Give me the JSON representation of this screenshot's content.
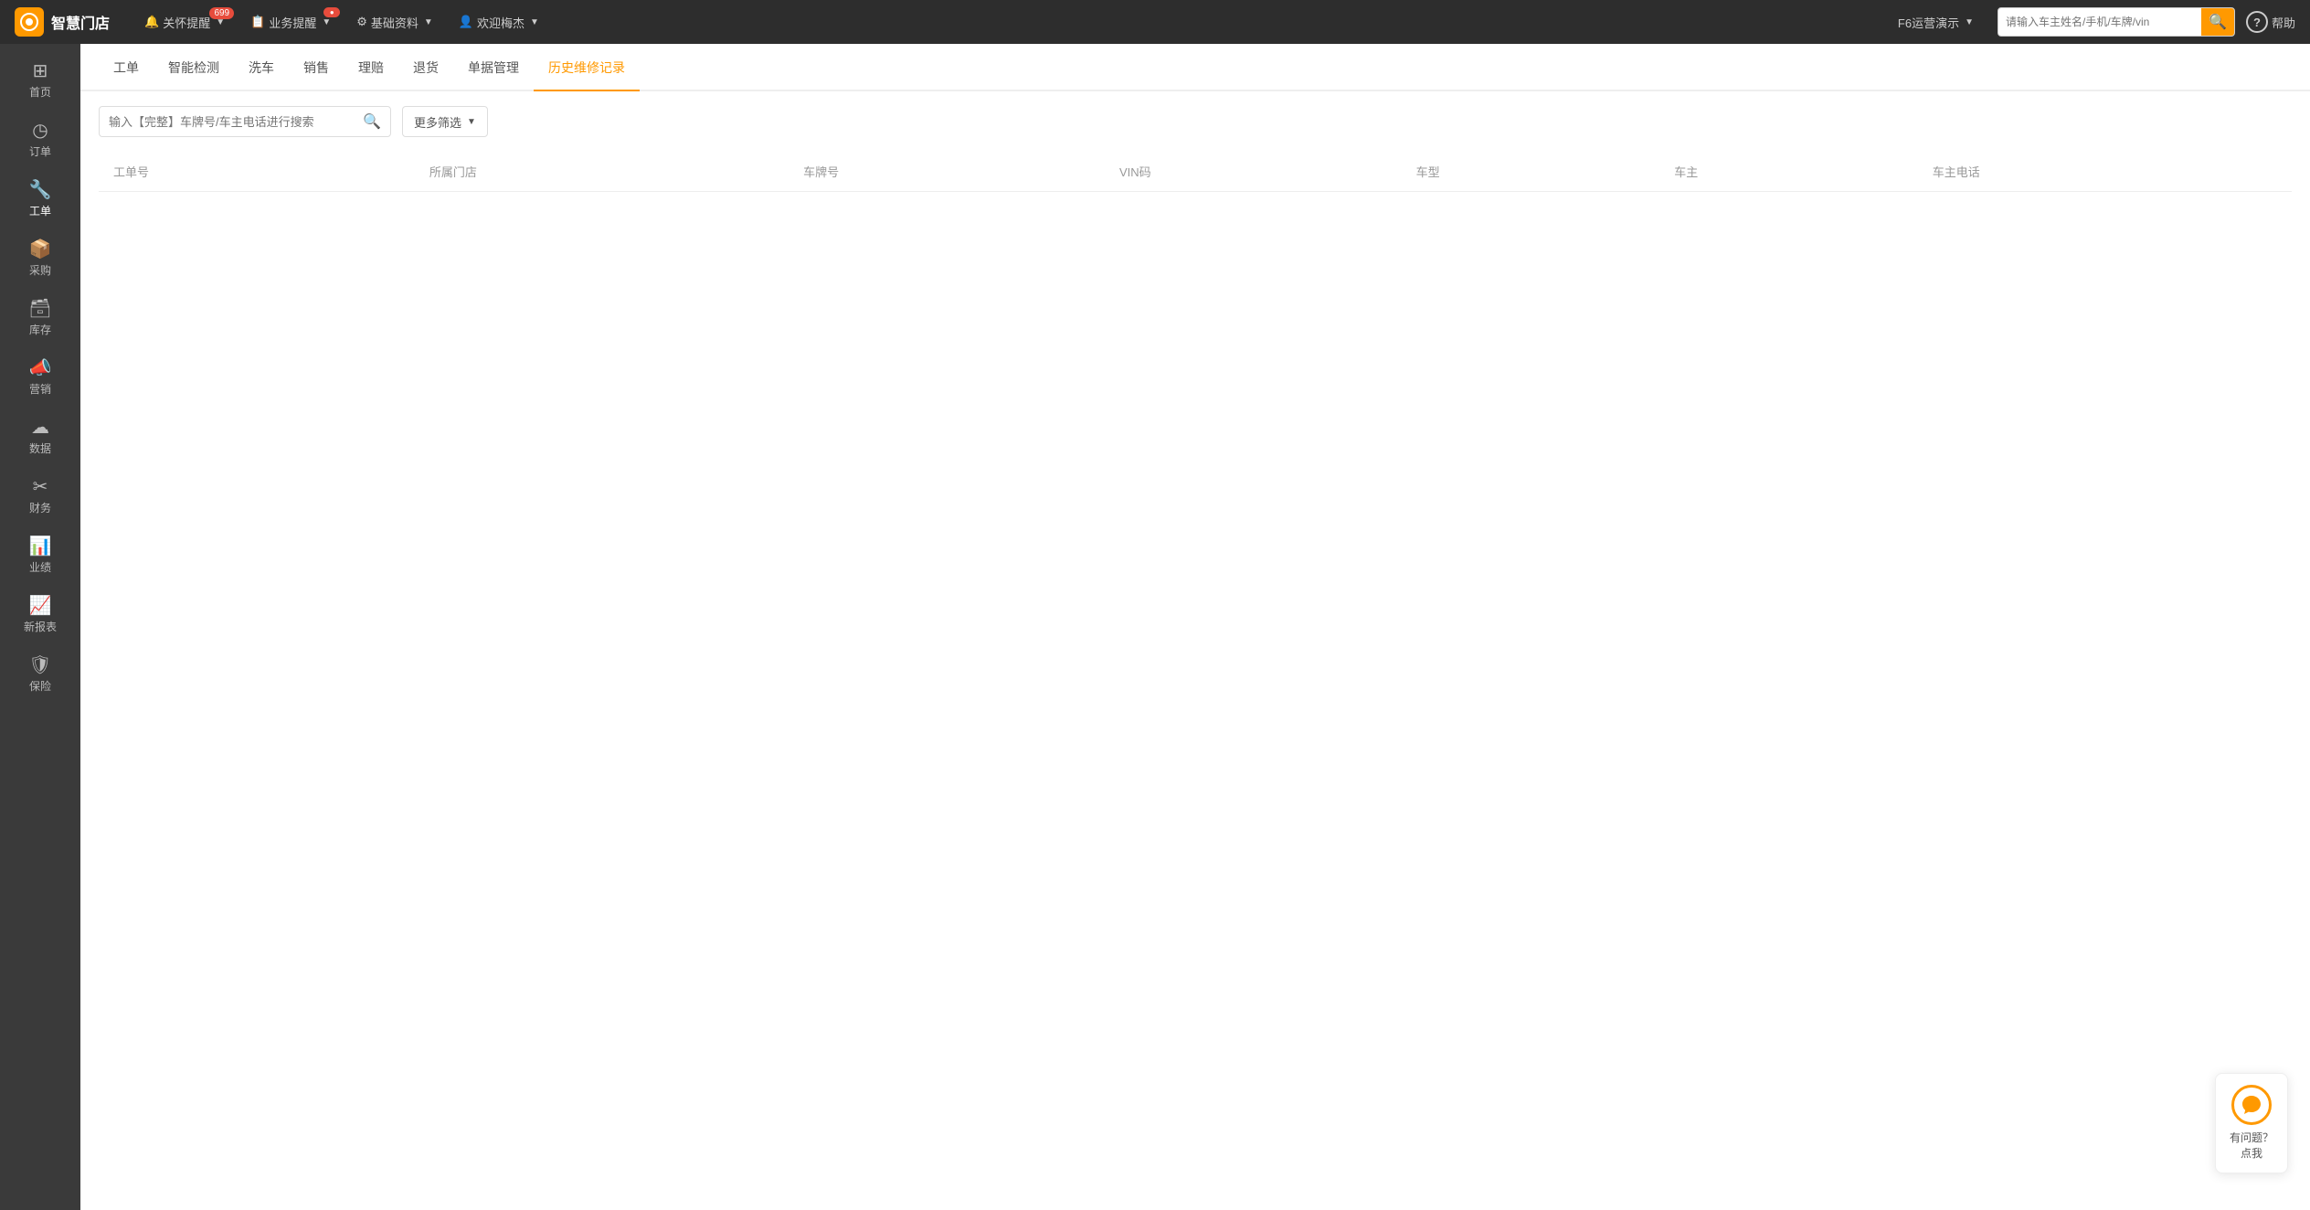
{
  "app": {
    "logo_text": "智慧门店",
    "logo_icon": "⚙"
  },
  "topnav": {
    "items": [
      {
        "id": "notification",
        "label": "关怀提醒",
        "badge": "699",
        "has_badge": true
      },
      {
        "id": "business",
        "label": "业务提醒",
        "badge": "●",
        "has_dot": true
      },
      {
        "id": "basic",
        "label": "基础资料"
      },
      {
        "id": "welcome",
        "label": "欢迎梅杰"
      }
    ],
    "operation": "F6运营演示",
    "search_placeholder": "请输入车主姓名/手机/车牌/vin",
    "help_label": "帮助"
  },
  "sidebar": {
    "items": [
      {
        "id": "home",
        "icon": "⊞",
        "label": "首页"
      },
      {
        "id": "order",
        "icon": "◷",
        "label": "订单"
      },
      {
        "id": "workorder",
        "icon": "🔧",
        "label": "工单"
      },
      {
        "id": "purchase",
        "icon": "📦",
        "label": "采购"
      },
      {
        "id": "inventory",
        "icon": "🗃",
        "label": "库存"
      },
      {
        "id": "marketing",
        "icon": "📣",
        "label": "营销"
      },
      {
        "id": "data",
        "icon": "☁",
        "label": "数据"
      },
      {
        "id": "finance",
        "icon": "✂",
        "label": "财务"
      },
      {
        "id": "performance",
        "icon": "📊",
        "label": "业绩"
      },
      {
        "id": "report",
        "icon": "📈",
        "label": "新报表"
      },
      {
        "id": "insurance",
        "icon": "⛿",
        "label": "保险"
      }
    ]
  },
  "tabs": [
    {
      "id": "workorder",
      "label": "工单"
    },
    {
      "id": "smart-detect",
      "label": "智能检测"
    },
    {
      "id": "carwash",
      "label": "洗车"
    },
    {
      "id": "sales",
      "label": "销售"
    },
    {
      "id": "claims",
      "label": "理赔"
    },
    {
      "id": "returns",
      "label": "退货"
    },
    {
      "id": "doc-manage",
      "label": "单据管理"
    },
    {
      "id": "history",
      "label": "历史维修记录",
      "active": true
    }
  ],
  "toolbar": {
    "search_placeholder": "输入【完整】车牌号/车主电话进行搜索",
    "filter_label": "更多筛选"
  },
  "table": {
    "columns": [
      {
        "id": "workorder-no",
        "label": "工单号"
      },
      {
        "id": "shop",
        "label": "所属门店"
      },
      {
        "id": "plate",
        "label": "车牌号"
      },
      {
        "id": "vin",
        "label": "VIN码"
      },
      {
        "id": "car-type",
        "label": "车型"
      },
      {
        "id": "owner",
        "label": "车主"
      },
      {
        "id": "phone",
        "label": "车主电话"
      }
    ],
    "rows": []
  },
  "chat_widget": {
    "line1": "有问题？",
    "line2": "点我"
  }
}
